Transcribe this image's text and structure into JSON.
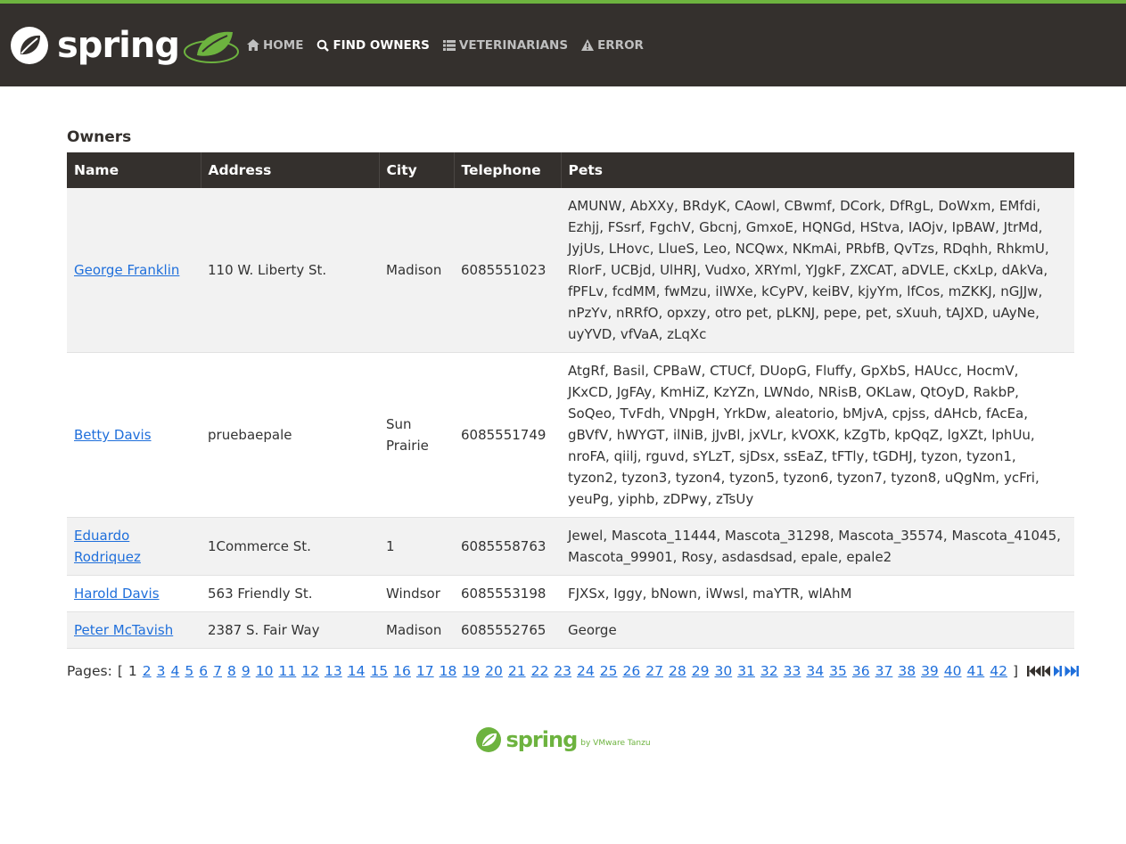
{
  "header": {
    "brand": "spring",
    "nav": [
      {
        "label": "Home",
        "icon": "home-icon",
        "active": false
      },
      {
        "label": "Find owners",
        "icon": "search-icon",
        "active": true
      },
      {
        "label": "Veterinarians",
        "icon": "list-icon",
        "active": false
      },
      {
        "label": "Error",
        "icon": "warning-icon",
        "active": false
      }
    ]
  },
  "main": {
    "title": "Owners",
    "columns": [
      "Name",
      "Address",
      "City",
      "Telephone",
      "Pets"
    ],
    "rows": [
      {
        "name": "George Franklin",
        "address": "110 W. Liberty St.",
        "city": "Madison",
        "telephone": "6085551023",
        "pets": "AMUNW, AbXXy, BRdyK, CAowl, CBwmf, DCork, DfRgL, DoWxm, EMfdi, Ezhjj, FSsrf, FgchV, Gbcnj, GmxoE, HQNGd, HStva, IAOjv, IpBAW, JtrMd, JyjUs, LHovc, LlueS, Leo, NCQwx, NKmAi, PRbfB, QvTzs, RDqhh, RhkmU, RlorF, UCBjd, UlHRJ, Vudxo, XRYml, YJgkF, ZXCAT, aDVLE, cKxLp, dAkVa, fPFLv, fcdMM, fwMzu, iIWXe, kCyPV, keiBV, kjyYm, lfCos, mZKKJ, nGJJw, nPzYv, nRRfO, opxzy, otro pet, pLKNJ, pepe, pet, sXuuh, tAJXD, uAyNe, uyYVD, vfVaA, zLqXc"
      },
      {
        "name": "Betty Davis",
        "address": "pruebaepale",
        "city": "Sun Prairie",
        "telephone": "6085551749",
        "pets": "AtgRf, Basil, CPBaW, CTUCf, DUopG, Fluffy, GpXbS, HAUcc, HocmV, JKxCD, JgFAy, KmHiZ, KzYZn, LWNdo, NRisB, OKLaw, QtOyD, RakbP, SoQeo, TvFdh, VNpgH, YrkDw, aleatorio, bMjvA, cpjss, dAHcb, fAcEa, gBVfV, hWYGT, ilNiB, jJvBl, jxVLr, kVOXK, kZgTb, kpQqZ, lgXZt, lphUu, nroFA, qiilj, rguvd, sYLzT, sjDsx, ssEaZ, tFTly, tGDHJ, tyzon, tyzon1, tyzon2, tyzon3, tyzon4, tyzon5, tyzon6, tyzon7, tyzon8, uQgNm, ycFri, yeuPg, yiphb, zDPwy, zTsUy"
      },
      {
        "name": "Eduardo Rodriquez",
        "address": "1Commerce St.",
        "city": "1",
        "telephone": "6085558763",
        "pets": "Jewel, Mascota_11444, Mascota_31298, Mascota_35574, Mascota_41045, Mascota_99901, Rosy, asdasdsad, epale, epale2"
      },
      {
        "name": "Harold Davis",
        "address": "563 Friendly St.",
        "city": "Windsor",
        "telephone": "6085553198",
        "pets": "FJXSx, Iggy, bNown, iWwsl, maYTR, wlAhM"
      },
      {
        "name": "Peter McTavish",
        "address": "2387 S. Fair Way",
        "city": "Madison",
        "telephone": "6085552765",
        "pets": "George"
      }
    ],
    "pagination": {
      "label": "Pages:",
      "open": "[",
      "close": "]",
      "current": "1",
      "pages": [
        "2",
        "3",
        "4",
        "5",
        "6",
        "7",
        "8",
        "9",
        "10",
        "11",
        "12",
        "13",
        "14",
        "15",
        "16",
        "17",
        "18",
        "19",
        "20",
        "21",
        "22",
        "23",
        "24",
        "25",
        "26",
        "27",
        "28",
        "29",
        "30",
        "31",
        "32",
        "33",
        "34",
        "35",
        "36",
        "37",
        "38",
        "39",
        "40",
        "41",
        "42"
      ]
    }
  },
  "footer": {
    "brand": "spring",
    "sub": "by VMware Tanzu"
  },
  "colors": {
    "brand_green": "#6db33f",
    "navbar": "#34302d",
    "link": "#1f6fdb"
  }
}
